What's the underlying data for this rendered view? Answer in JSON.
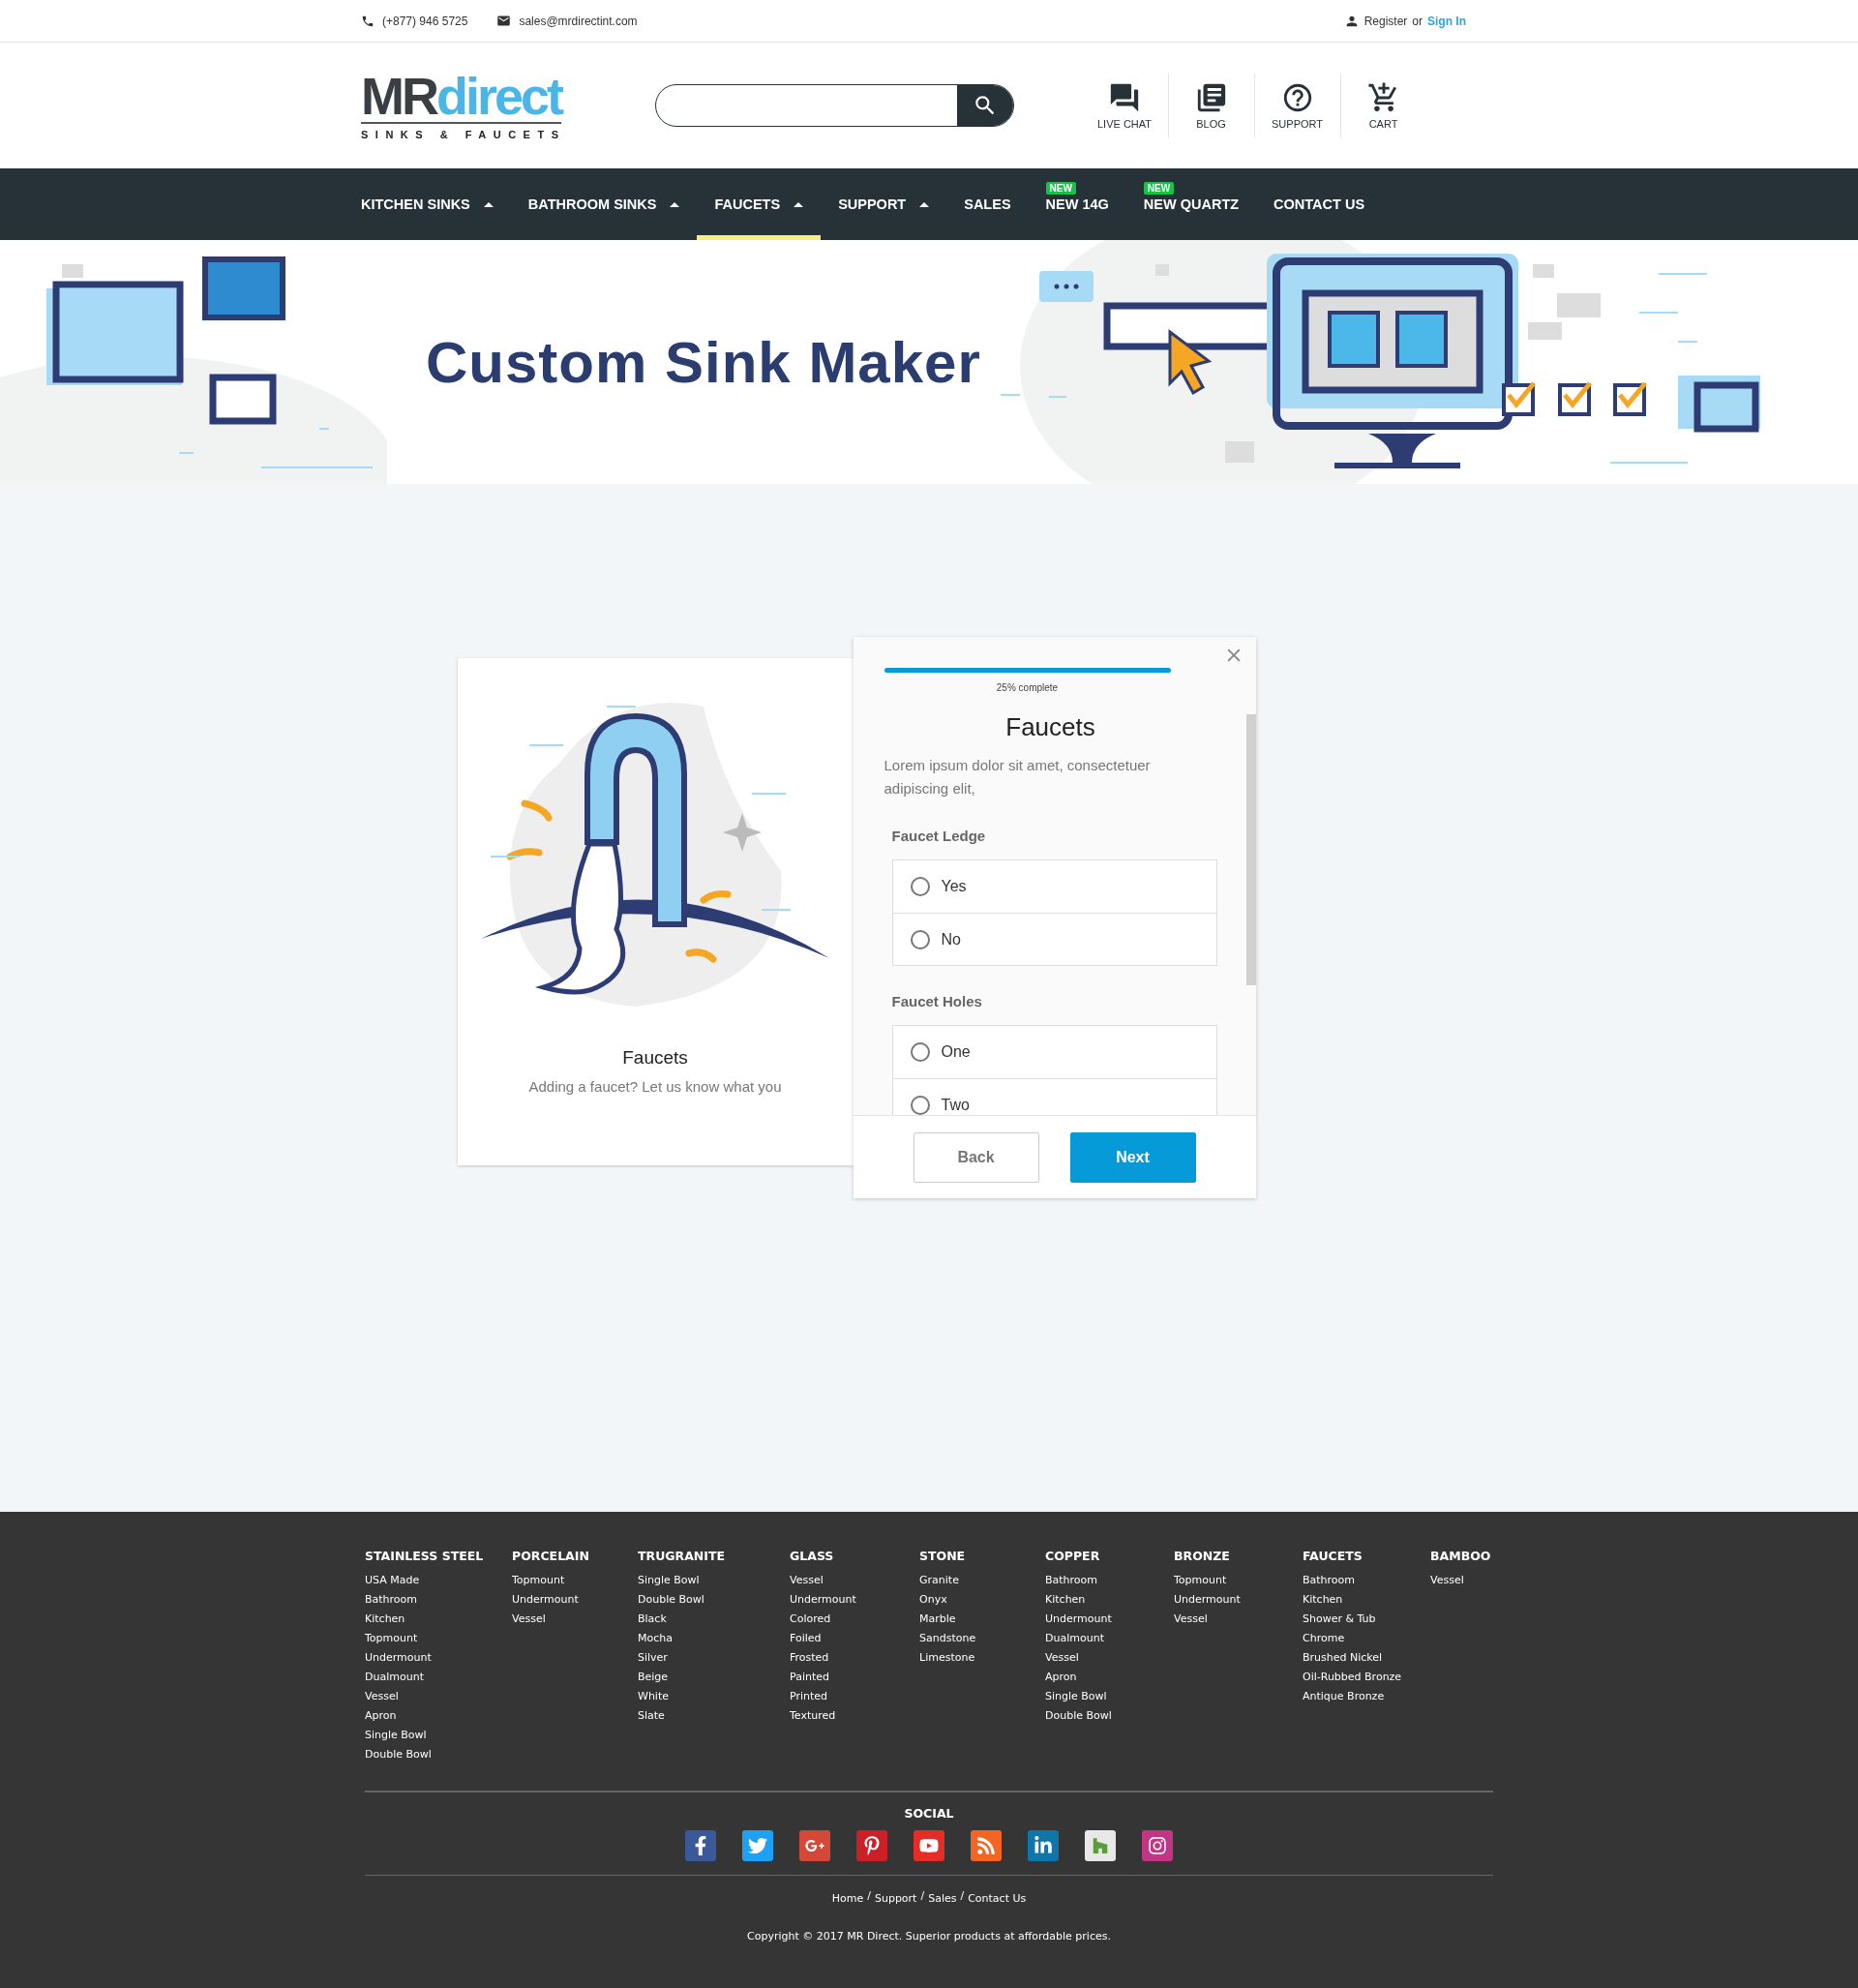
{
  "top_bar": {
    "phone": "(+877) 946 5725",
    "email": "sales@mrdirectint.com",
    "register": "Register",
    "or": "or",
    "sign_in": "Sign In"
  },
  "header": {
    "logo": {
      "main": "MR",
      "accent": "direct",
      "tagline": "SINKS & FAUCETS"
    },
    "actions": [
      {
        "kind": "chat",
        "label": "LIVE CHAT"
      },
      {
        "kind": "blog",
        "label": "BLOG"
      },
      {
        "kind": "support",
        "label": "SUPPORT"
      },
      {
        "kind": "cart",
        "label": "CART"
      }
    ]
  },
  "nav": [
    {
      "label": "KITCHEN SINKS",
      "has_menu": true,
      "selected": false
    },
    {
      "label": "BATHROOM SINKS",
      "has_menu": true,
      "selected": false
    },
    {
      "label": "FAUCETS",
      "has_menu": true,
      "selected": true
    },
    {
      "label": "SUPPORT",
      "has_menu": true,
      "selected": false
    },
    {
      "label": "SALES",
      "has_menu": false,
      "selected": false
    },
    {
      "label": "NEW 14G",
      "has_menu": false,
      "selected": false,
      "badge": "NEW"
    },
    {
      "label": "NEW QUARTZ",
      "has_menu": false,
      "selected": false,
      "badge": "NEW"
    },
    {
      "label": "CONTACT US",
      "has_menu": false,
      "selected": false
    }
  ],
  "banner": {
    "title": "Custom Sink Maker"
  },
  "intro_card": {
    "title": "Faucets",
    "text": "Adding a faucet? Let us know what you"
  },
  "wizard": {
    "progress": {
      "level": 1,
      "reading": "25% complete"
    },
    "title": "Faucets",
    "description": "Lorem ipsum dolor sit amet, consectetuer adipiscing elit,",
    "groups": [
      {
        "label": "Faucet Ledge",
        "options": [
          {
            "label": "Yes",
            "selected": false
          },
          {
            "label": "No",
            "selected": false
          }
        ]
      },
      {
        "label": "Faucet Holes",
        "options": [
          {
            "label": "One",
            "selected": false
          },
          {
            "label": "Two",
            "selected": false
          }
        ]
      }
    ],
    "buttons": [
      {
        "kind": "secondary",
        "label": "Back"
      },
      {
        "kind": "primary",
        "label": "Next"
      }
    ]
  },
  "footer": {
    "columns": [
      {
        "title": "STAINLESS STEEL",
        "links": [
          "USA Made",
          "Bathroom",
          "Kitchen",
          "Topmount",
          "Undermount",
          "Dualmount",
          "Vessel",
          "Apron",
          "Single Bowl",
          "Double Bowl"
        ]
      },
      {
        "title": "PORCELAIN",
        "links": [
          "Topmount",
          "Undermount",
          "Vessel"
        ]
      },
      {
        "title": "TRUGRANITE",
        "links": [
          "Single Bowl",
          "Double Bowl",
          "Black",
          "Mocha",
          "Silver",
          "Beige",
          "White",
          "Slate"
        ]
      },
      {
        "title": "GLASS",
        "links": [
          "Vessel",
          "Undermount",
          "Colored",
          "Foiled",
          "Frosted",
          "Painted",
          "Printed",
          "Textured"
        ]
      },
      {
        "title": "STONE",
        "links": [
          "Granite",
          "Onyx",
          "Marble",
          "Sandstone",
          "Limestone"
        ]
      },
      {
        "title": "COPPER",
        "links": [
          "Bathroom",
          "Kitchen",
          "Undermount",
          "Dualmount",
          "Vessel",
          "Apron",
          "Single Bowl",
          "Double Bowl"
        ]
      },
      {
        "title": "BRONZE",
        "links": [
          "Topmount",
          "Undermount",
          "Vessel"
        ]
      },
      {
        "title": "FAUCETS",
        "links": [
          "Bathroom",
          "Kitchen",
          "Shower & Tub",
          "Chrome",
          "Brushed Nickel",
          "Oil-Rubbed Bronze",
          "Antique Bronze"
        ]
      },
      {
        "title": "BAMBOO",
        "links": [
          "Vessel"
        ]
      }
    ],
    "social_title": "SOCIAL",
    "social": [
      {
        "kind": "facebook"
      },
      {
        "kind": "twitter"
      },
      {
        "kind": "googleplus"
      },
      {
        "kind": "pinterest"
      },
      {
        "kind": "youtube"
      },
      {
        "kind": "rss"
      },
      {
        "kind": "linkedin"
      },
      {
        "kind": "houzz"
      },
      {
        "kind": "instagram"
      }
    ],
    "bottom_links": [
      "Home",
      "Support",
      "Sales",
      "Contact Us"
    ],
    "separator": "/",
    "copyright": "Copyright © 2017 MR Direct. Superior products at affordable prices."
  }
}
